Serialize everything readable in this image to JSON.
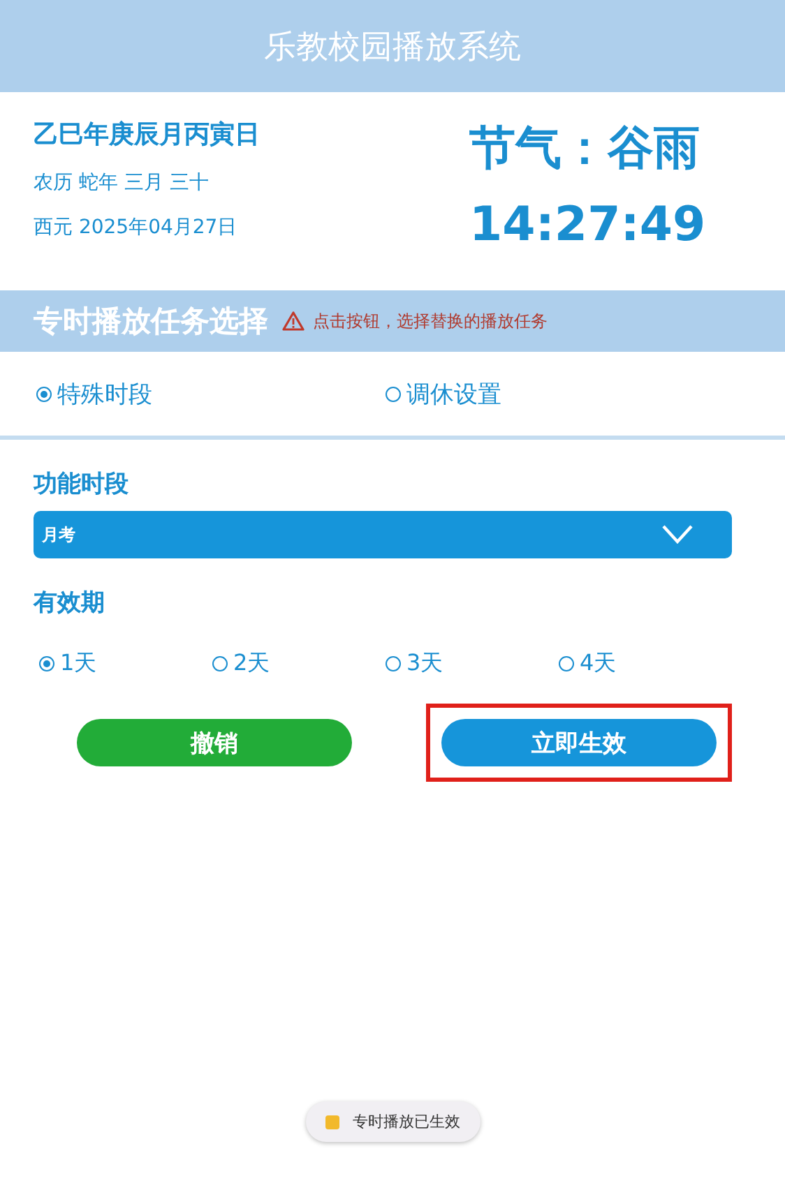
{
  "header": {
    "title": "乐教校园播放系统"
  },
  "date_info": {
    "ganzhi": "乙巳年庚辰月丙寅日",
    "lunar": "农历 蛇年 三月 三十",
    "solar": "西元 2025年04月27日",
    "solar_term": "节气：谷雨",
    "time": "14:27:49"
  },
  "task_section": {
    "title": "专时播放任务选择",
    "warning": "点击按钮，选择替换的播放任务"
  },
  "task_options": [
    {
      "label": "特殊时段",
      "selected": true
    },
    {
      "label": "调休设置",
      "selected": false
    }
  ],
  "period": {
    "label": "功能时段",
    "value": "月考"
  },
  "validity": {
    "label": "有效期",
    "options": [
      {
        "label": "1天",
        "selected": true
      },
      {
        "label": "2天",
        "selected": false
      },
      {
        "label": "3天",
        "selected": false
      },
      {
        "label": "4天",
        "selected": false
      }
    ]
  },
  "buttons": [
    {
      "label": "撤销",
      "kind": "cancel",
      "highlighted": false
    },
    {
      "label": "立即生效",
      "kind": "confirm",
      "highlighted": true
    }
  ],
  "toast": {
    "text": "专时播放已生效"
  }
}
